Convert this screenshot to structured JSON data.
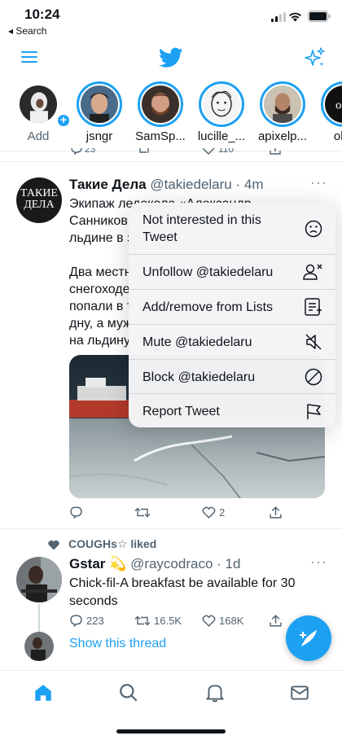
{
  "status_bar": {
    "time": "10:24",
    "back_label": "◂ Search"
  },
  "fleets": [
    {
      "label": "Add"
    },
    {
      "label": "jsngr"
    },
    {
      "label": "SamSp..."
    },
    {
      "label": "lucille_..."
    },
    {
      "label": "apixelp..."
    },
    {
      "label": "oby"
    }
  ],
  "partial_row": {
    "reply_count": "23",
    "like_count": "110"
  },
  "tweet1": {
    "avatar_text": [
      "ТАКИЕ",
      "ДЕЛА"
    ],
    "name": "Такие Дела",
    "handle": "@takiedelaru",
    "time": "· 4m",
    "lines": [
      "Экипаж ледокола «Александр",
      "Санников",
      "льдине в з",
      "",
      "Два местн",
      "снегоходе",
      "попали в т",
      "дну, а муж",
      "на льдину"
    ],
    "likes": "2"
  },
  "menu": {
    "items": [
      {
        "label": "Not interested in this Tweet",
        "icon": "frown-icon"
      },
      {
        "label": "Unfollow @takiedelaru",
        "icon": "unfollow-icon"
      },
      {
        "label": "Add/remove from Lists",
        "icon": "list-icon"
      },
      {
        "label": "Mute @takiedelaru",
        "icon": "mute-icon"
      },
      {
        "label": "Block @takiedelaru",
        "icon": "block-icon"
      },
      {
        "label": "Report Tweet",
        "icon": "flag-icon"
      }
    ]
  },
  "tweet2": {
    "liked_by": "COUGHs☆ liked",
    "name": "Gstar",
    "emoji": "💫",
    "handle": "@raycodraco",
    "time": "· 1d",
    "text": "Chick-fil-A breakfast be available for 30 seconds",
    "replies": "223",
    "retweets": "16.5K",
    "likes": "168K",
    "show_thread": "Show this thread"
  },
  "colors": {
    "accent": "#1da1f2",
    "muted": "#536471"
  }
}
